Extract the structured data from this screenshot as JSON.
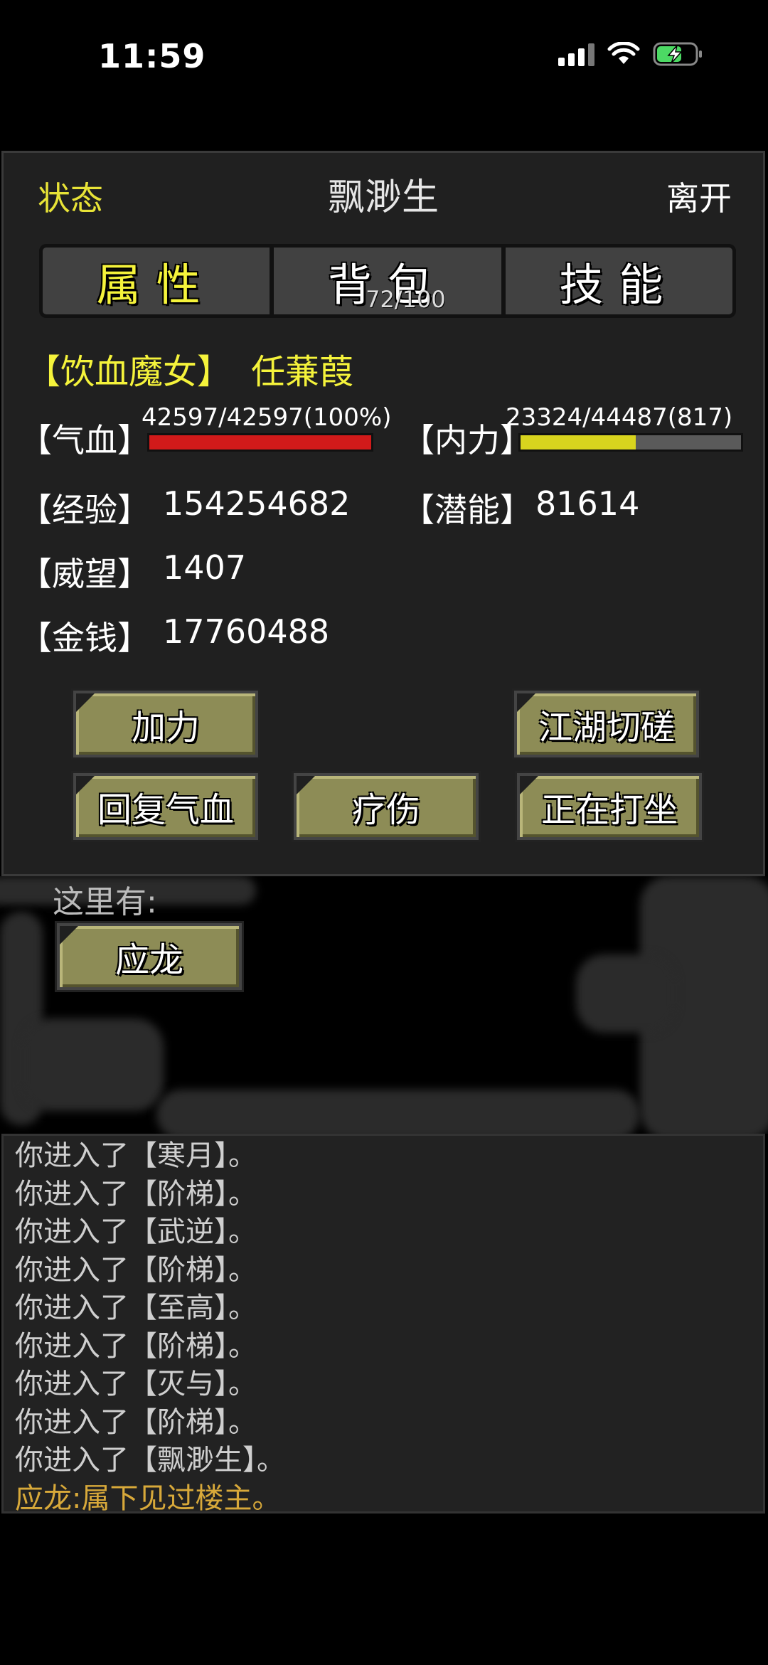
{
  "status_bar": {
    "time": "11:59"
  },
  "panel": {
    "status_label": "状态",
    "title": "飘渺生",
    "leave_label": "离开"
  },
  "tabs": [
    {
      "label": "属性",
      "active": true
    },
    {
      "label": "背包",
      "active": false,
      "count": "72/100"
    },
    {
      "label": "技能",
      "active": false
    }
  ],
  "character": {
    "title": "【饮血魔女】",
    "name": "任蒹葭"
  },
  "stats": {
    "hp_label": "【气血】",
    "hp_text": "42597/42597(100%)",
    "hp_fraction": 1.0,
    "mp_label": "【内力】",
    "mp_text": "23324/44487(817)",
    "mp_fraction": 0.524,
    "exp_label": "【经验】",
    "exp_value": "154254682",
    "potential_label": "【潜能】",
    "potential_value": "81614",
    "prestige_label": "【威望】",
    "prestige_value": "1407",
    "money_label": "【金钱】",
    "money_value": "17760488"
  },
  "buttons": {
    "boost": "加力",
    "spar": "江湖切磋",
    "restore_hp": "回复气血",
    "heal": "疗伤",
    "meditate": "正在打坐"
  },
  "scene": {
    "here_label": "这里有:",
    "npc": "应龙"
  },
  "log": [
    "你进入了【寒月】。",
    "你进入了【阶梯】。",
    "你进入了【武逆】。",
    "你进入了【阶梯】。",
    "你进入了【至高】。",
    "你进入了【阶梯】。",
    "你进入了【灭与】。",
    "你进入了【阶梯】。",
    "你进入了【飘渺生】。"
  ],
  "log_speech": "应龙:属下见过楼主。",
  "colors": {
    "accent_yellow": "#f5f33b",
    "hp_bar": "#d11a1a",
    "mp_bar": "#d8d41e",
    "button": "#8d8c56",
    "speech": "#d8a93a"
  }
}
